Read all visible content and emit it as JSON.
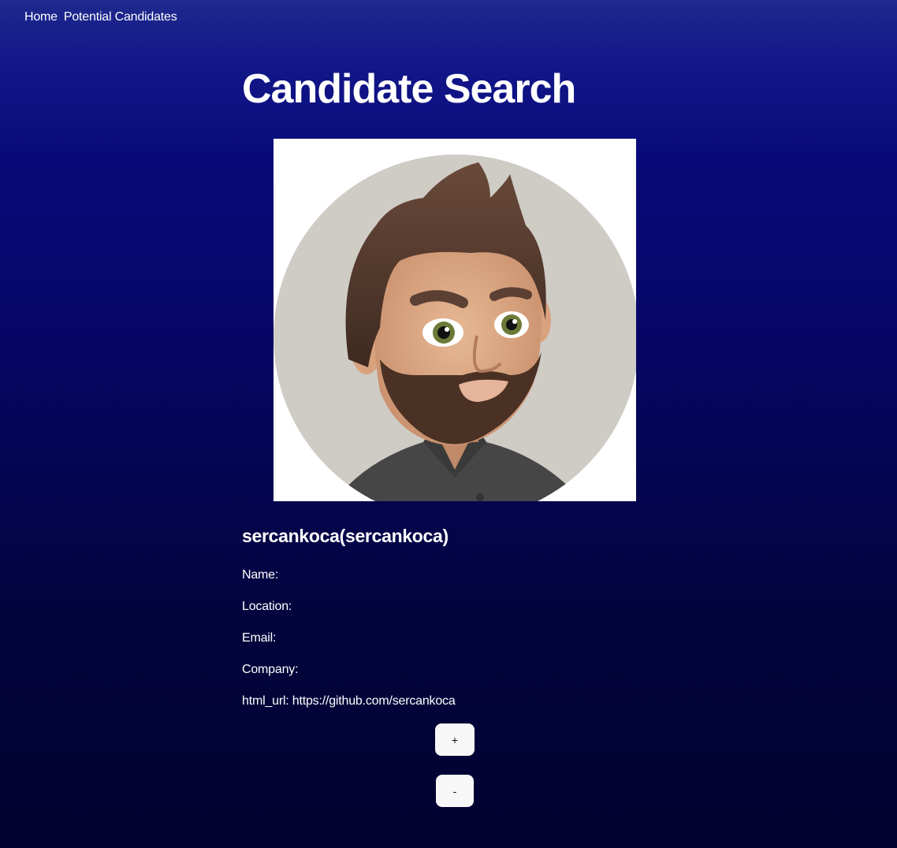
{
  "nav": {
    "home_label": "Home",
    "candidates_label": "Potential Candidates"
  },
  "page": {
    "title": "Candidate Search"
  },
  "candidate": {
    "heading": "sercankoca(sercankoca)",
    "fields": {
      "name": "Name:",
      "location": "Location:",
      "email": "Email:",
      "company": "Company:",
      "html_url": "html_url: https://github.com/sercankoca"
    },
    "avatar_icon": "memoji-avatar"
  },
  "actions": {
    "add_label": "+",
    "remove_label": "-"
  },
  "colors": {
    "background_top": "#1e2a8c",
    "background_bottom": "#02022f",
    "button_bg": "#f7f7f7",
    "text": "#ffffff"
  }
}
